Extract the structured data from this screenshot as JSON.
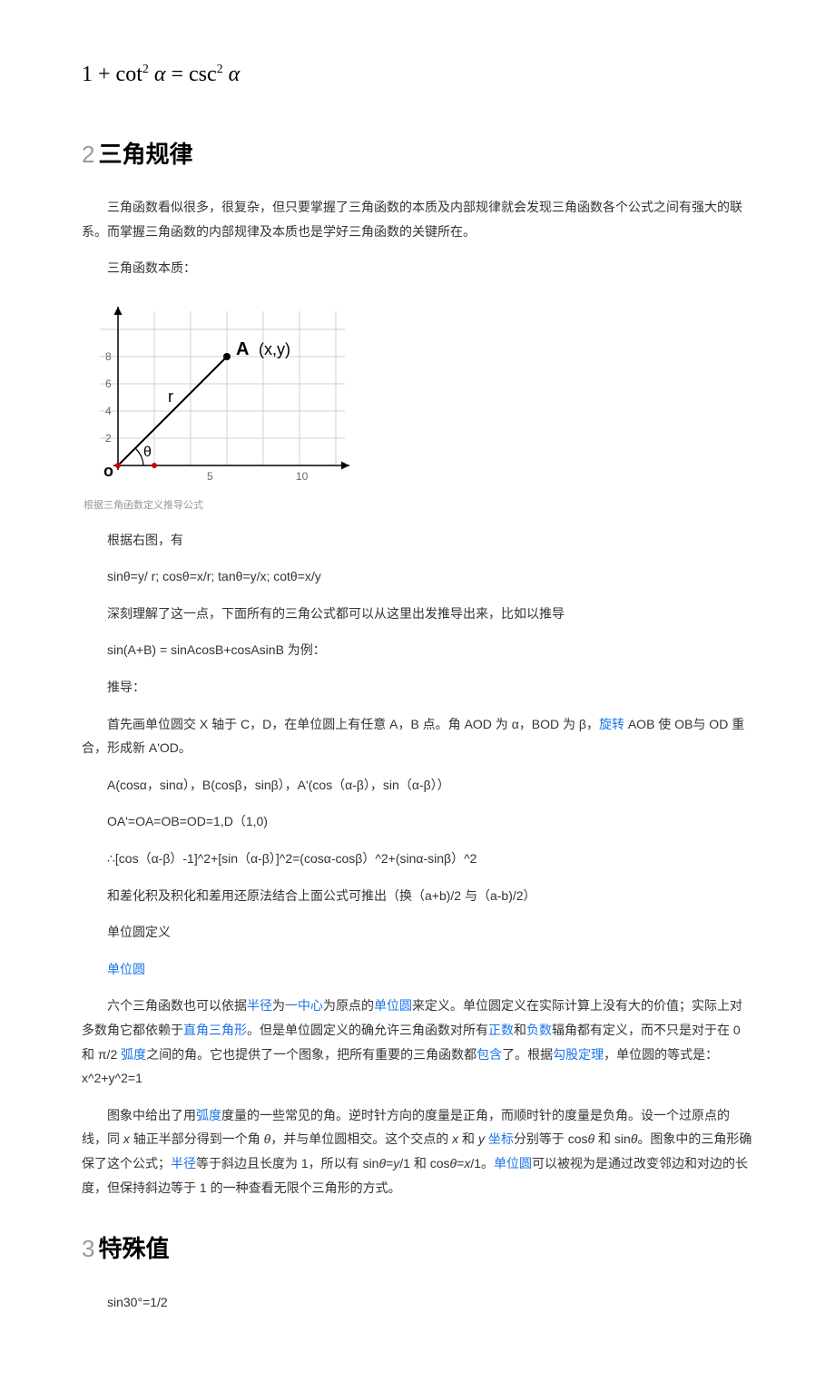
{
  "formula": "1 + cot² α = csc² α",
  "sections": {
    "s2": {
      "num": "2",
      "title": "三角规律",
      "p1": "三角函数看似很多，很复杂，但只要掌握了三角函数的本质及内部规律就会发现三角函数各个公式之间有强大的联系。而掌握三角函数的内部规律及本质也是学好三角函数的关键所在。",
      "p2": "三角函数本质：",
      "graph_A": "A",
      "graph_xy": "(x,y)",
      "graph_r": "r",
      "graph_theta": "θ",
      "graph_o": "o",
      "graph_5": "5",
      "graph_10": "10",
      "graph_y2": "2",
      "graph_y4": "4",
      "graph_y6": "6",
      "graph_y8": "8",
      "caption": "根据三角函数定义推导公式",
      "p3": "根据右图，有",
      "p4": "sinθ=y/ r; cosθ=x/r; tanθ=y/x; cotθ=x/y",
      "p5": "深刻理解了这一点，下面所有的三角公式都可以从这里出发推导出来，比如以推导",
      "p6": "sin(A+B) = sinAcosB+cosAsinB 为例：",
      "p7": "推导：",
      "p8_a": "首先画单位圆交 X 轴于 C，D，在单位圆上有任意 A，B 点。角 AOD 为 α，BOD 为 β，",
      "p8_link": "旋转",
      "p8_b": " AOB 使 OB与 OD 重合，形成新 A'OD。",
      "p9": "A(cosα，sinα），B(cosβ，sinβ），A'(cos（α-β），sin（α-β））",
      "p10": "OA'=OA=OB=OD=1,D（1,0)",
      "p11": "∴[cos（α-β）-1]^2+[sin（α-β）]^2=(cosα-cosβ）^2+(sinα-sinβ）^2",
      "p12": "和差化积及积化和差用还原法结合上面公式可推出（换（a+b)/2 与（a-b)/2）",
      "p13": "单位圆定义",
      "p14_link": "单位圆",
      "p15_a": "六个三角函数也可以依据",
      "p15_l1": "半径",
      "p15_b": "为",
      "p15_l2": "一",
      "p15_l3": "中心",
      "p15_c": "为原点的",
      "p15_l4": "单位圆",
      "p15_d": "来定义。单位圆定义在实际计算上没有大的价值；实际上对多数角它都依赖于",
      "p15_l5": "直角三角形",
      "p15_e": "。但是单位圆定义的确允许三角函数对所有",
      "p15_l6": "正数",
      "p15_f": "和",
      "p15_l7": "负数",
      "p15_g": "辐角都有定义，而不只是对于在 0 和 π/2 ",
      "p15_l8": "弧度",
      "p15_h": "之间的角。它也提供了一个图象，把所有重要的三角函数都",
      "p15_l9": "包含",
      "p15_i": "了。根据",
      "p15_l10": "勾股定理",
      "p15_j": "，单位圆的等式是：x^2+y^2=1",
      "p16_a": "图象中给出了用",
      "p16_l1": "弧度",
      "p16_b": "度量的一些常见的角。逆时针方向的度量是正角，而顺时针的度量是负角。设一个过原点的线，同 ",
      "p16_i1": "x",
      "p16_c": " 轴正半部分得到一个角 ",
      "p16_i2": "θ",
      "p16_d": "，并与单位圆相交。这个交点的 ",
      "p16_i3": "x",
      "p16_e": " 和 ",
      "p16_i4": "y",
      "p16_l2": " 坐标",
      "p16_f": "分别等于 cos",
      "p16_i5": "θ",
      "p16_g": " 和 sin",
      "p16_i6": "θ",
      "p16_h": "。图象中的三角形确保了这个公式；",
      "p16_l3": "半径",
      "p16_i": "等于斜边且长度为 1，所以有 sin",
      "p16_i7": "θ",
      "p16_j": "=",
      "p16_i8": "y",
      "p16_k": "/1 和 cos",
      "p16_i9": "θ",
      "p16_l": "=",
      "p16_i10": "x",
      "p16_m": "/1。",
      "p16_l4": "单位圆",
      "p16_n": "可以被视为是通过改变邻边和对边的长度，但保持斜边等于 1 的一种查看无限个三角形的方式。"
    },
    "s3": {
      "num": "3",
      "title": "特殊值",
      "p1": "sin30°=1/2"
    }
  }
}
